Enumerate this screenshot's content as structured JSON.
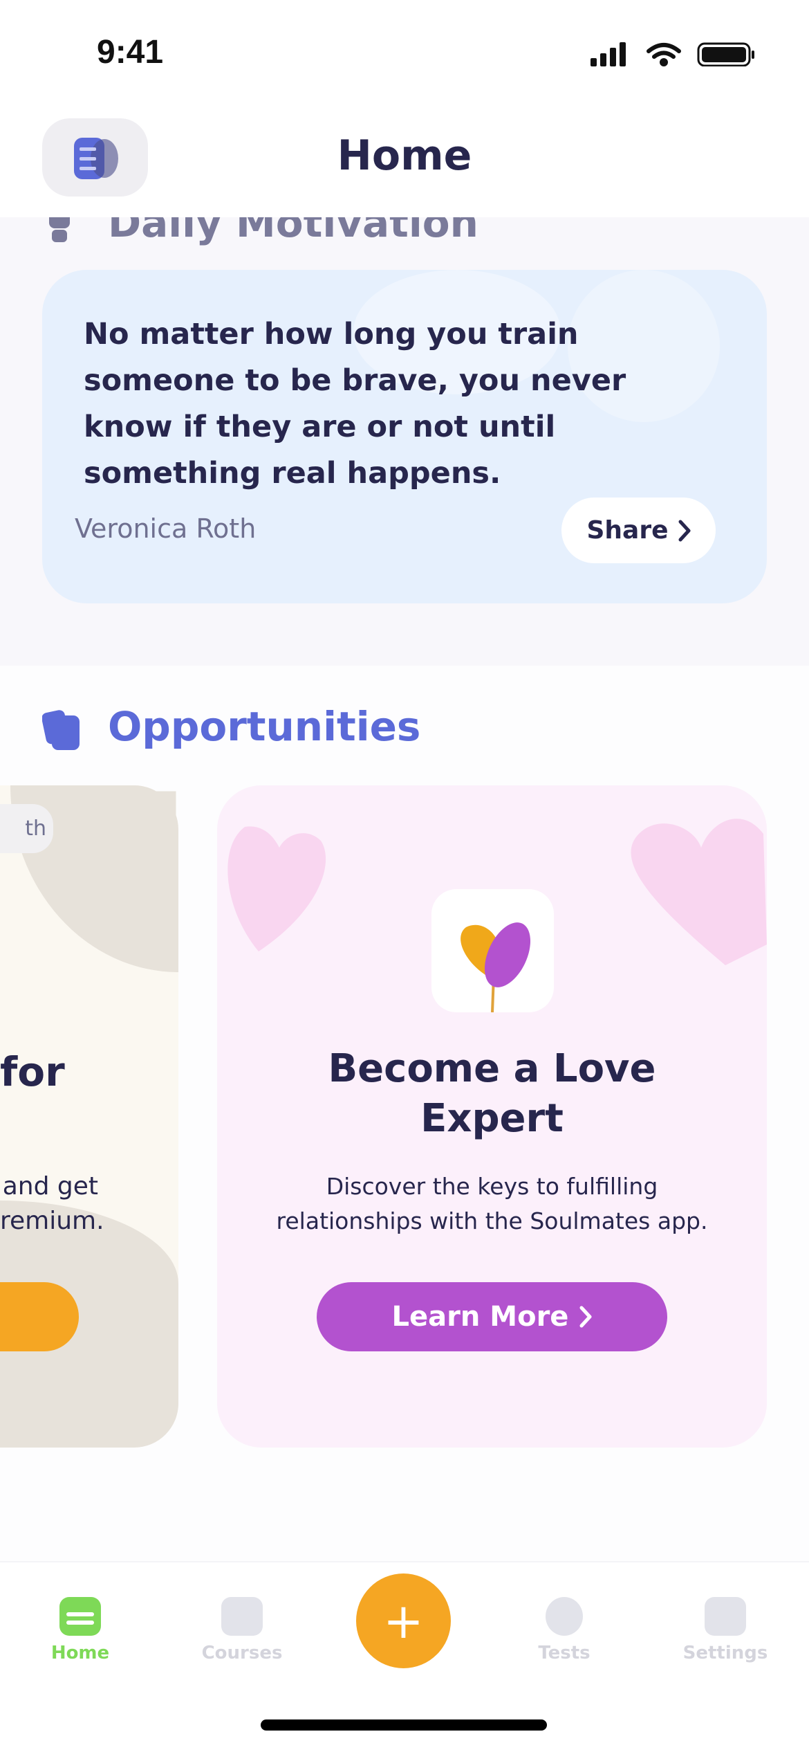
{
  "status_bar": {
    "time": "9:41"
  },
  "header": {
    "title": "Home"
  },
  "daily_motivation": {
    "title": "Daily Motivation",
    "quote_lines": [
      "No matter how long you train",
      "someone to be brave, you never",
      "know if they are or not until",
      "something real happens."
    ],
    "author": "Veronica Roth",
    "share_label": "Share"
  },
  "opportunities": {
    "title": "Opportunities",
    "cards": [
      {
        "chip": "th",
        "title": "for",
        "description_lines": [
          "and get",
          "remium."
        ],
        "button_color": "#f5a623"
      },
      {
        "title_lines": [
          "Become a Love",
          "Expert"
        ],
        "description_lines": [
          "Discover the keys to fulfilling",
          "relationships with the Soulmates app."
        ],
        "button_label": "Learn More",
        "button_color": "#b352cf"
      }
    ]
  },
  "tabbar": {
    "items": [
      {
        "label": "Home",
        "active": true
      },
      {
        "label": "Courses"
      },
      {
        "label": "Tests"
      },
      {
        "label": "Settings"
      }
    ],
    "active_color": "#7ed957",
    "fab_color": "#f5a623"
  }
}
